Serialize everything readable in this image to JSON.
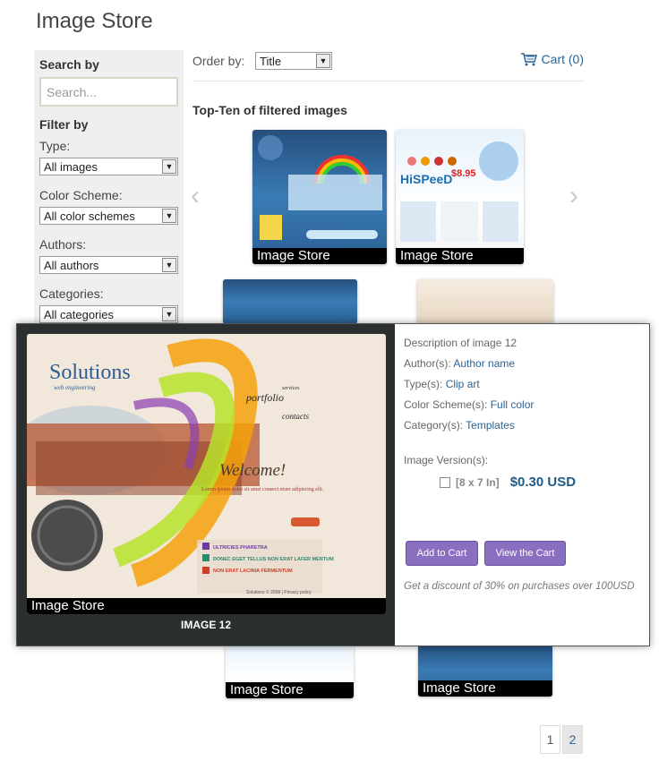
{
  "page_title": "Image Store",
  "sidebar": {
    "search_heading": "Search by",
    "search_placeholder": "Search...",
    "filter_heading": "Filter by",
    "filters": [
      {
        "label": "Type:",
        "value": "All images"
      },
      {
        "label": "Color Scheme:",
        "value": "All color schemes"
      },
      {
        "label": "Authors:",
        "value": "All authors"
      },
      {
        "label": "Categories:",
        "value": "All categories"
      }
    ]
  },
  "toolbar": {
    "order_label": "Order by:",
    "order_value": "Title",
    "cart_label": "Cart (0)"
  },
  "section_title": "Top-Ten of filtered images",
  "thumbnails": [
    {
      "caption": "Image Store"
    },
    {
      "caption": "Image Store"
    },
    {
      "caption": "Image Store"
    },
    {
      "caption": "Image Store"
    }
  ],
  "modal": {
    "image_caption": "Image Store",
    "image_name": "IMAGE 12",
    "description": "Description of image 12",
    "author_label": "Author(s):",
    "author_value": "Author name",
    "type_label": "Type(s):",
    "type_value": "Clip art",
    "color_label": "Color Scheme(s):",
    "color_value": "Full color",
    "category_label": "Category(s):",
    "category_value": "Templates",
    "version_label": "Image Version(s):",
    "version_size": "[8 x 7 In]",
    "version_price": "$0.30 USD",
    "add_to_cart": "Add to Cart",
    "view_cart": "View the Cart",
    "discount_note": "Get a discount of 30% on purchases over 100USD",
    "art_text": {
      "solutions": "Solutions",
      "subtitle": "web engineering",
      "welcome": "Welcome!",
      "portfolio": "portfolio",
      "contacts": "contacts",
      "services": "services",
      "lorem": "Lorem ipsum dolor sit amet consect etuer adipiscing elit.",
      "list1": "ULTRICIES PHARETRA",
      "list2": "DONEC EGET TELLUS NON ERAT LAFER MENTUM",
      "list3": "NON ERAT LACINIA FERMENTUM",
      "footer": "Solutions © 2008 | Privacy policy"
    }
  },
  "pagination": [
    "1",
    "2"
  ],
  "colors": {
    "link": "#2a6496",
    "button": "#8a6fc0",
    "modal_dark": "#2c2f30",
    "sidebar_bg": "#efefef"
  }
}
